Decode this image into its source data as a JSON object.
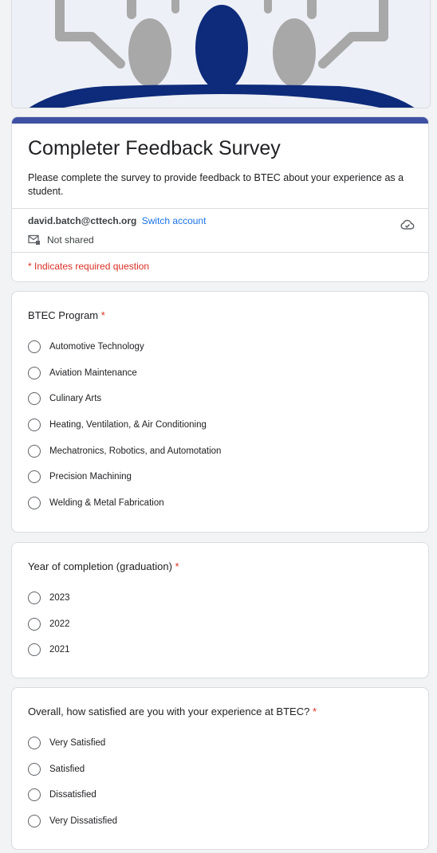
{
  "form": {
    "title": "Completer Feedback Survey",
    "description": "Please complete the survey to provide feedback to BTEC about your experience as a student.",
    "account_email": "david.batch@cttech.org",
    "switch_account": "Switch account",
    "share_status": "Not shared",
    "required_note": "* Indicates required question"
  },
  "questions": [
    {
      "title": "BTEC Program",
      "required_marker": "*",
      "options": [
        "Automotive Technology",
        "Aviation Maintenance",
        "Culinary Arts",
        "Heating, Ventilation, & Air Conditioning",
        "Mechatronics, Robotics, and Automotation",
        "Precision Machining",
        "Welding & Metal Fabrication"
      ]
    },
    {
      "title": "Year of completion (graduation)",
      "required_marker": "*",
      "options": [
        "2023",
        "2022",
        "2021"
      ]
    },
    {
      "title": "Overall, how satisfied are you with your experience at BTEC?",
      "required_marker": "*",
      "options": [
        "Very Satisfied",
        "Satisfied",
        "Dissatisfied",
        "Very Dissatisfied"
      ]
    }
  ],
  "colors": {
    "header_bar": "#3f51a3",
    "link": "#1a73e8",
    "required": "#d93025",
    "banner_navy": "#0d2b7a",
    "banner_gray": "#a8a8a8"
  },
  "icons": {
    "cloud": "cloud-check-icon",
    "not_shared": "mail-lock-icon"
  }
}
